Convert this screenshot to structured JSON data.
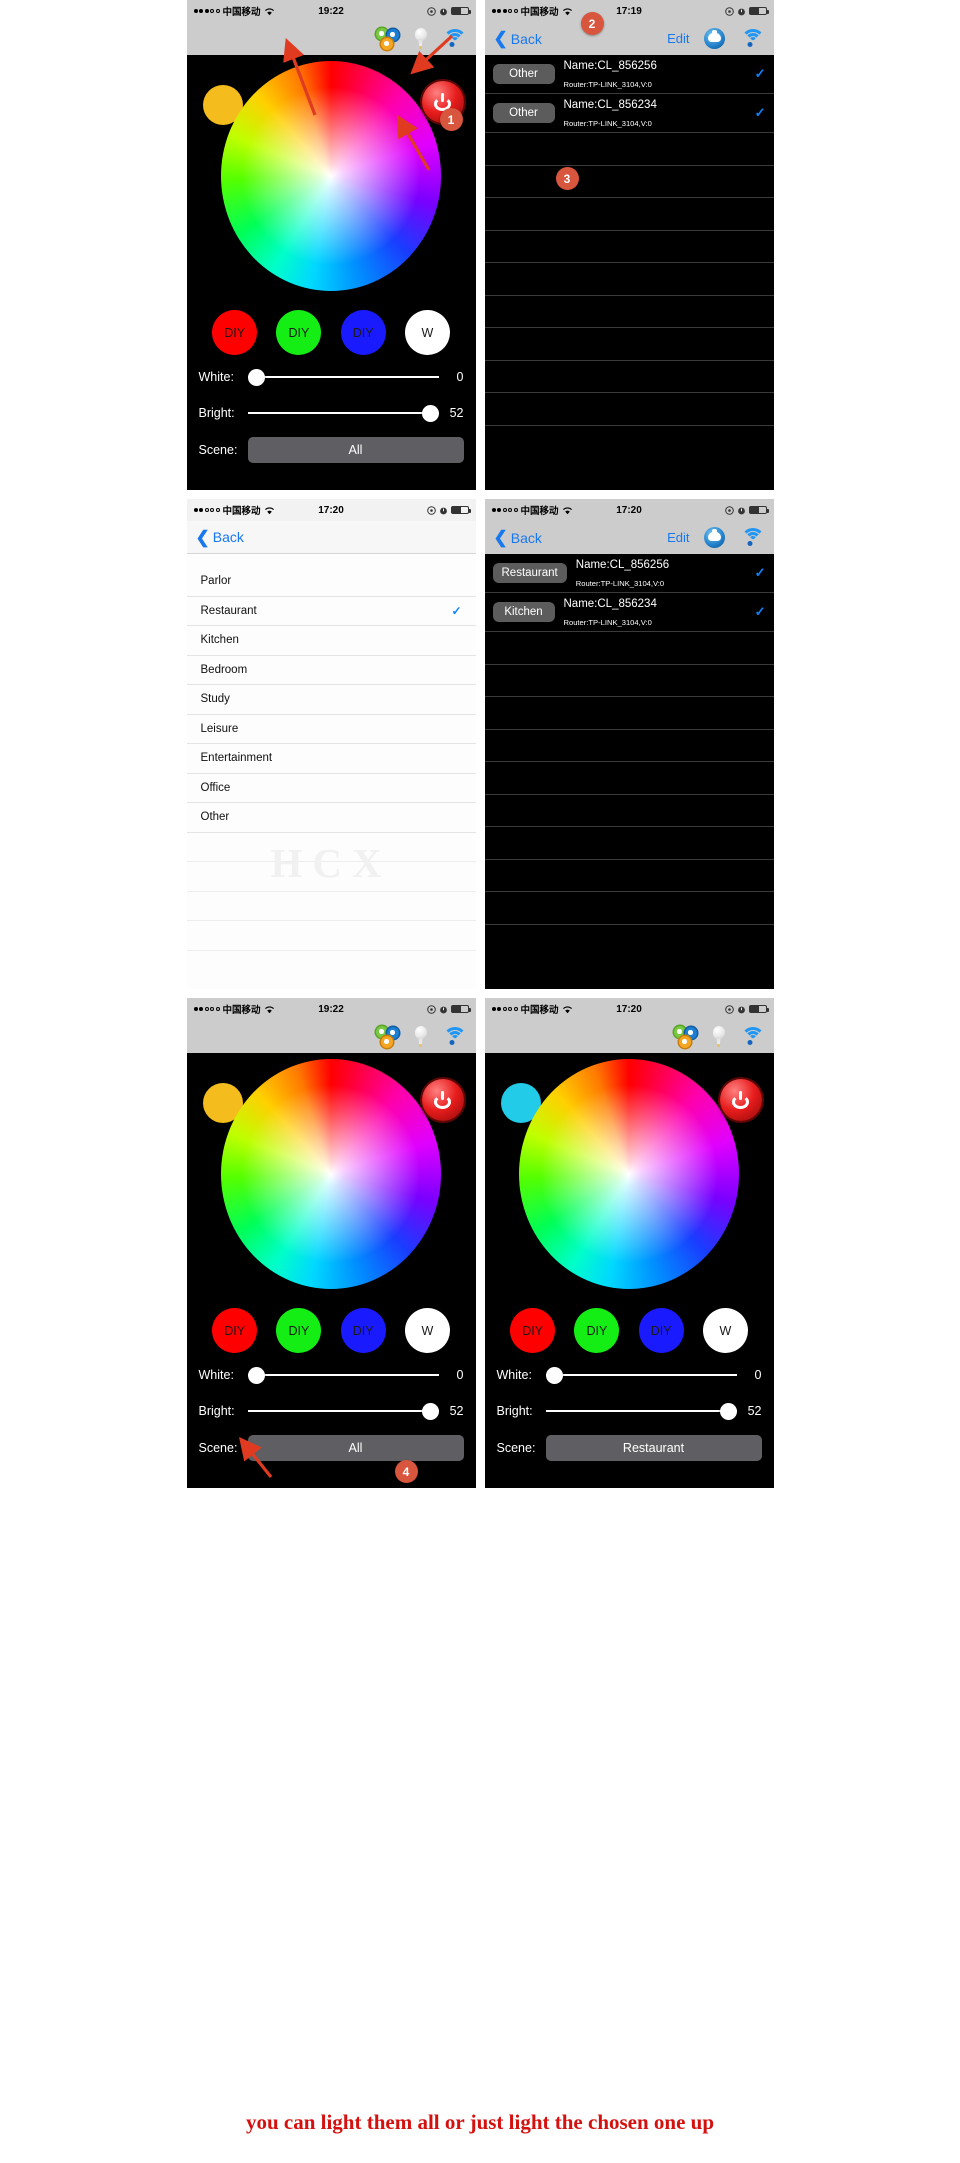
{
  "statusbars": {
    "carrier": "中国移动",
    "time_1922": "19:22",
    "time_1719": "17:19",
    "time_1720": "17:20"
  },
  "nav": {
    "back_label": "Back",
    "edit_label": "Edit",
    "chevron": "‹"
  },
  "icons": {
    "gears": "gears-icon",
    "bulb": "bulb-icon",
    "wifi": "wifi-icon",
    "robot": "robot-icon",
    "power": "power-icon",
    "check": "✓"
  },
  "controller": {
    "diy_buttons": [
      {
        "label": "DIY",
        "color": "#ff0000"
      },
      {
        "label": "DIY",
        "color": "#15ee15"
      },
      {
        "label": "DIY",
        "color": "#1a1aff"
      },
      {
        "label": "W",
        "color": "#ffffff"
      }
    ],
    "white_label": "White:",
    "white_value": "0",
    "bright_label": "Bright:",
    "bright_value": "52",
    "scene_label": "Scene:",
    "scene_value_all": "All",
    "scene_value_restaurant": "Restaurant",
    "swatch_yellow": "#f5bc1e",
    "swatch_cyan": "#22cbe8",
    "power_color": "#e81c1c"
  },
  "devices": {
    "panel2": [
      {
        "tag": "Other",
        "name": "Name:CL_856256",
        "router": "Router:TP-LINK_3104,V:0",
        "checked": true
      },
      {
        "tag": "Other",
        "name": "Name:CL_856234",
        "router": "Router:TP-LINK_3104,V:0",
        "checked": true
      }
    ],
    "panel4": [
      {
        "tag": "Restaurant",
        "name": "Name:CL_856256",
        "router": "Router:TP-LINK_3104,V:0",
        "checked": true
      },
      {
        "tag": "Kitchen",
        "name": "Name:CL_856234",
        "router": "Router:TP-LINK_3104,V:0",
        "checked": true
      }
    ]
  },
  "scene_list": {
    "items": [
      {
        "label": "Parlor",
        "selected": false
      },
      {
        "label": "Restaurant",
        "selected": true
      },
      {
        "label": "Kitchen",
        "selected": false
      },
      {
        "label": "Bedroom",
        "selected": false
      },
      {
        "label": "Study",
        "selected": false
      },
      {
        "label": "Leisure",
        "selected": false
      },
      {
        "label": "Entertainment",
        "selected": false
      },
      {
        "label": "Office",
        "selected": false
      },
      {
        "label": "Other",
        "selected": false
      }
    ],
    "watermark": "HCX"
  },
  "annotations": {
    "m1": "1",
    "m2": "2",
    "m3": "3",
    "m4": "4",
    "color": "#d8553e"
  },
  "footer": {
    "caption": "you can light them all or just light the chosen one up",
    "color": "#d4110f"
  }
}
